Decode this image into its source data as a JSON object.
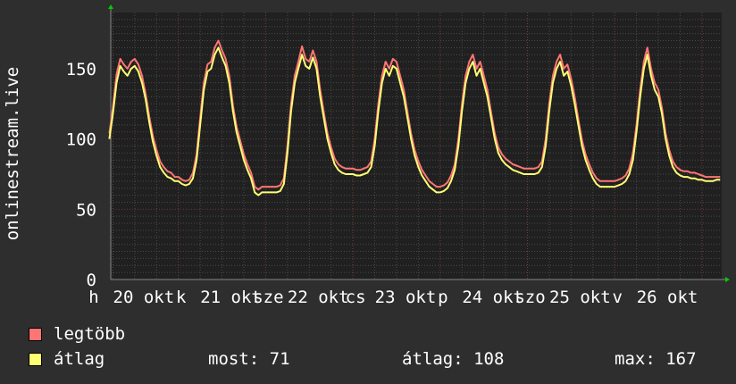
{
  "chart_data": {
    "type": "line",
    "ylabel": "onlinestream.live",
    "ylim": [
      0,
      190
    ],
    "yticks": [
      0,
      50,
      100,
      150
    ],
    "x_start_hour": 5,
    "x_unit": "hour",
    "weekday_labels": [
      "h",
      "k",
      "sze",
      "cs",
      "p",
      "szo",
      "v"
    ],
    "date_labels": [
      "20 okt",
      "21 okt",
      "22 okt",
      "23 okt",
      "24 okt",
      "25 okt",
      "26 okt"
    ],
    "grid": true,
    "series": [
      {
        "name": "legtöbb",
        "color": "#ff7575",
        "values": [
          104,
          122,
          146,
          157,
          153,
          150,
          155,
          157,
          153,
          145,
          132,
          116,
          102,
          92,
          84,
          80,
          77,
          76,
          73,
          73,
          71,
          70,
          71,
          76,
          89,
          115,
          140,
          153,
          155,
          165,
          170,
          163,
          157,
          145,
          124,
          109,
          99,
          89,
          82,
          76,
          66,
          64,
          66,
          66,
          66,
          66,
          66,
          67,
          72,
          95,
          125,
          145,
          155,
          166,
          157,
          155,
          163,
          155,
          135,
          119,
          104,
          94,
          86,
          82,
          80,
          79,
          79,
          79,
          78,
          78,
          79,
          80,
          84,
          100,
          125,
          145,
          155,
          150,
          157,
          155,
          145,
          135,
          119,
          104,
          92,
          84,
          78,
          74,
          70,
          68,
          66,
          66,
          67,
          69,
          74,
          82,
          100,
          125,
          145,
          155,
          160,
          150,
          155,
          145,
          135,
          119,
          104,
          94,
          89,
          86,
          84,
          82,
          81,
          80,
          79,
          79,
          79,
          79,
          80,
          84,
          100,
          125,
          145,
          155,
          160,
          150,
          153,
          143,
          130,
          114,
          99,
          89,
          82,
          76,
          72,
          70,
          70,
          70,
          70,
          70,
          71,
          72,
          74,
          79,
          90,
          110,
          135,
          155,
          165,
          150,
          140,
          135,
          122,
          104,
          92,
          84,
          80,
          78,
          77,
          77,
          76,
          76,
          75,
          74,
          73,
          73,
          73,
          73,
          73
        ]
      },
      {
        "name": "átlag",
        "color": "#ffff73",
        "values": [
          100,
          118,
          140,
          152,
          148,
          145,
          150,
          152,
          148,
          140,
          128,
          112,
          98,
          88,
          80,
          76,
          73,
          72,
          70,
          70,
          68,
          67,
          68,
          72,
          85,
          110,
          135,
          148,
          150,
          160,
          165,
          158,
          152,
          140,
          120,
          105,
          95,
          85,
          78,
          72,
          62,
          60,
          62,
          62,
          62,
          62,
          62,
          63,
          68,
          90,
          120,
          140,
          150,
          160,
          152,
          150,
          158,
          150,
          130,
          115,
          100,
          90,
          82,
          78,
          76,
          75,
          75,
          75,
          74,
          74,
          75,
          76,
          80,
          95,
          120,
          140,
          150,
          145,
          152,
          150,
          140,
          130,
          115,
          100,
          88,
          80,
          74,
          70,
          66,
          64,
          62,
          62,
          63,
          65,
          70,
          78,
          95,
          120,
          140,
          150,
          155,
          145,
          150,
          140,
          130,
          115,
          100,
          90,
          85,
          82,
          80,
          78,
          77,
          76,
          75,
          75,
          75,
          75,
          76,
          80,
          95,
          120,
          140,
          150,
          155,
          145,
          148,
          138,
          125,
          110,
          95,
          85,
          78,
          72,
          68,
          66,
          66,
          66,
          66,
          66,
          67,
          68,
          70,
          75,
          85,
          105,
          130,
          150,
          160,
          145,
          135,
          130,
          118,
          100,
          88,
          80,
          76,
          74,
          73,
          73,
          72,
          72,
          71,
          71,
          70,
          70,
          70,
          71,
          71
        ]
      }
    ]
  },
  "legend": {
    "max_label": "legtöbb",
    "avg_label": "átlag",
    "now": "most: 71",
    "average": "átlag: 108",
    "maximum": "max: 167"
  }
}
